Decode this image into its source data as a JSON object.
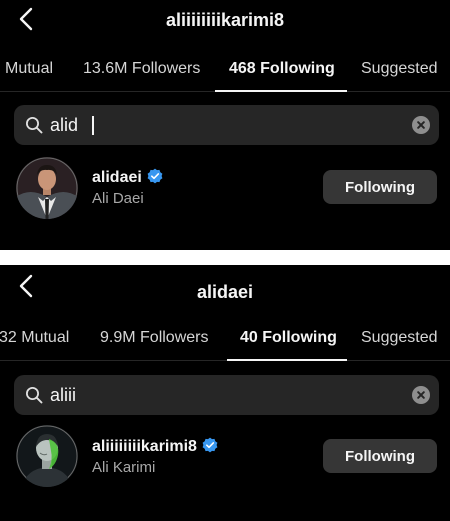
{
  "screens": [
    {
      "title": "aliiiiiiiikarimi8",
      "tabs": [
        {
          "label": "Mutual"
        },
        {
          "label": "13.6M Followers"
        },
        {
          "label": "468 Following",
          "active": true
        },
        {
          "label": "Suggested"
        }
      ],
      "search": {
        "value": "alid"
      },
      "result": {
        "username": "alidaei",
        "full_name": "Ali Daei",
        "verified": true,
        "button_label": "Following"
      }
    },
    {
      "title": "alidaei",
      "tabs": [
        {
          "label": "32 Mutual"
        },
        {
          "label": "9.9M Followers"
        },
        {
          "label": "40 Following",
          "active": true
        },
        {
          "label": "Suggested"
        }
      ],
      "search": {
        "value": "aliii"
      },
      "result": {
        "username": "aliiiiiiiikarimi8",
        "full_name": "Ali Karimi",
        "verified": true,
        "button_label": "Following"
      }
    }
  ],
  "icons": {
    "back": "chevron-left-icon",
    "search": "search-icon",
    "clear": "clear-circle-icon",
    "verified": "verified-badge-icon"
  },
  "colors": {
    "background": "#000000",
    "search_field": "#262626",
    "button": "#363636",
    "verified_blue": "#3897f0",
    "secondary_text": "#a8a8a8"
  }
}
